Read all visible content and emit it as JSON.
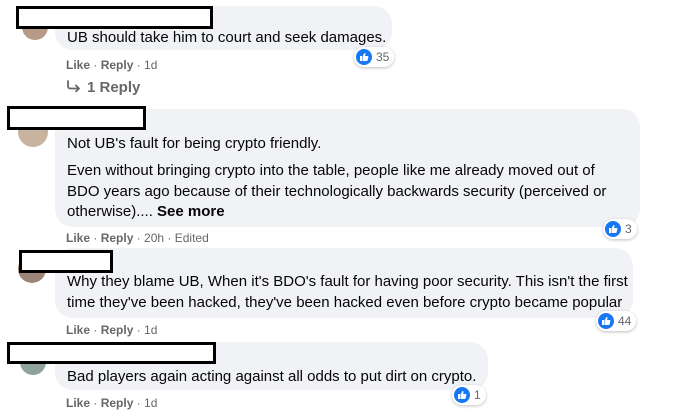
{
  "comments": [
    {
      "text_lines": [
        "UB should take him to court and seek damages."
      ],
      "actions": {
        "like": "Like",
        "reply": "Reply",
        "time": "1d",
        "edited": ""
      },
      "reactions": "35",
      "replies_link": "1 Reply"
    },
    {
      "text_lines": [
        "Not UB's fault for being crypto friendly.",
        "Even without bringing crypto into the table, people like me already moved out of",
        "BDO years ago because of their technologically backwards security (perceived or"
      ],
      "last_line": "otherwise)....",
      "see_more": "See more",
      "actions": {
        "like": "Like",
        "reply": "Reply",
        "time": "20h",
        "edited": "Edited"
      },
      "reactions": "3"
    },
    {
      "text_lines": [
        "Why they blame UB, When it's BDO's fault for having poor security. This isn't the first",
        "time they've been hacked, they've been hacked even before crypto became popular"
      ],
      "actions": {
        "like": "Like",
        "reply": "Reply",
        "time": "1d",
        "edited": ""
      },
      "reactions": "44"
    },
    {
      "text_lines": [
        "Bad players again acting against all odds to put dirt on crypto."
      ],
      "actions": {
        "like": "Like",
        "reply": "Reply",
        "time": "1d",
        "edited": ""
      },
      "reactions": "1"
    }
  ],
  "icons": {
    "like": "thumbs-up-icon",
    "reply": "reply-arrow-icon"
  },
  "colors": {
    "bubble": "#f0f2f5",
    "meta": "#65676b",
    "like_blue": "#1877f2"
  }
}
